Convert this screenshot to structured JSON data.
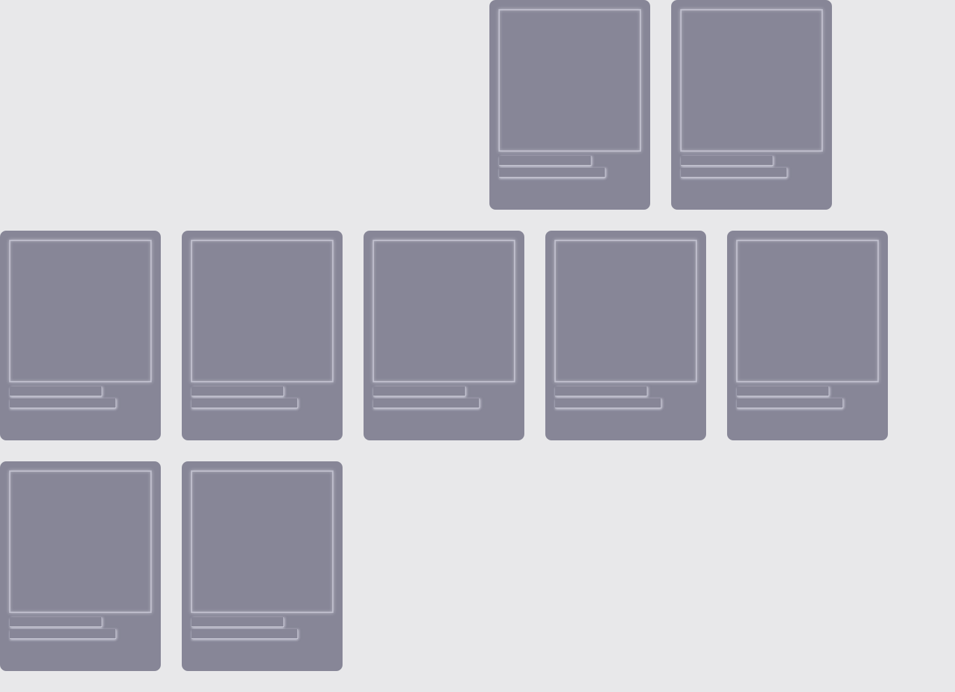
{
  "colors": {
    "background": "#e8e8ea",
    "card": "#878697",
    "outline": "#d6d6e2"
  },
  "state": "loading-skeleton",
  "cards": [
    {
      "row": 1,
      "col": 3
    },
    {
      "row": 1,
      "col": 4
    },
    {
      "row": 2,
      "col": 1
    },
    {
      "row": 2,
      "col": 2
    },
    {
      "row": 2,
      "col": 3
    },
    {
      "row": 2,
      "col": 4
    },
    {
      "row": 2,
      "col": 5
    },
    {
      "row": 3,
      "col": 1
    },
    {
      "row": 3,
      "col": 2
    }
  ]
}
